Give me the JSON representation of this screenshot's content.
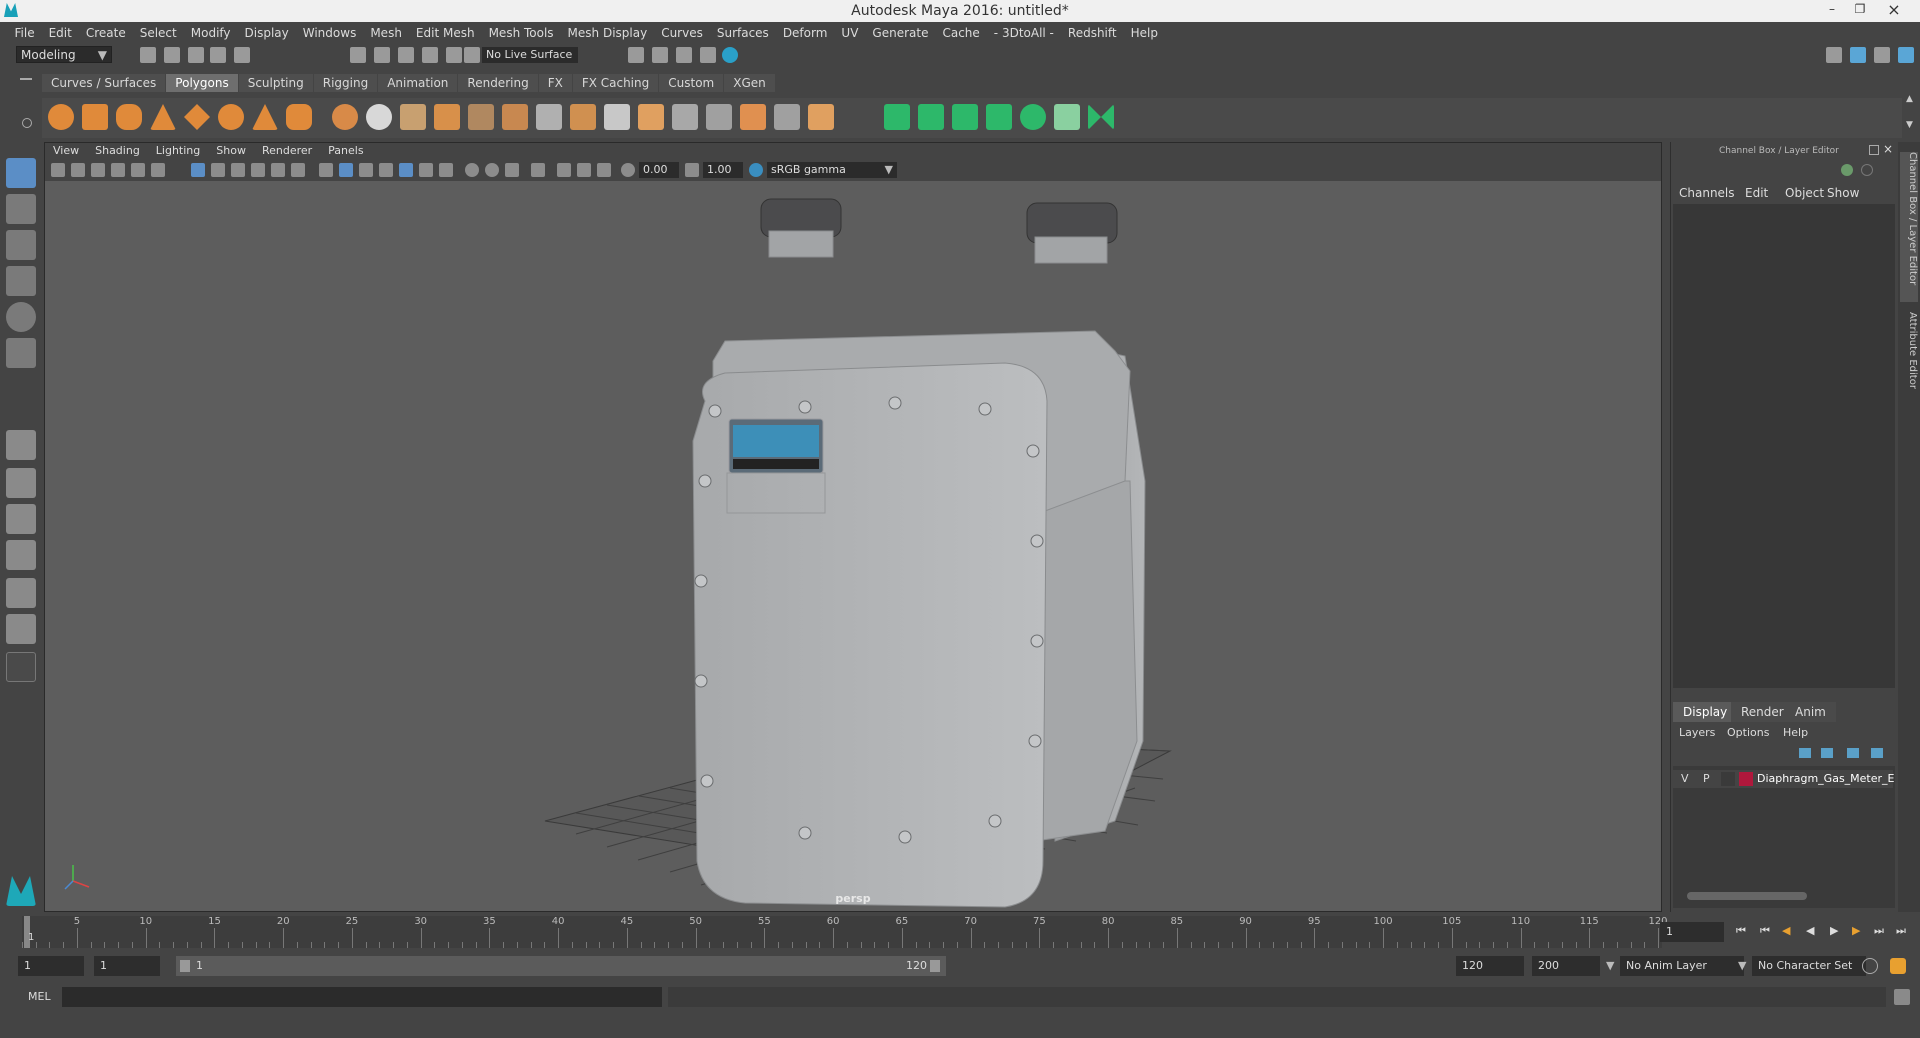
{
  "window": {
    "title": "Autodesk Maya 2016: untitled*"
  },
  "menus": [
    "File",
    "Edit",
    "Create",
    "Select",
    "Modify",
    "Display",
    "Windows",
    "Mesh",
    "Edit Mesh",
    "Mesh Tools",
    "Mesh Display",
    "Curves",
    "Surfaces",
    "Deform",
    "UV",
    "Generate",
    "Cache",
    "- 3DtoAll -",
    "Redshift",
    "Help"
  ],
  "status": {
    "mode": "Modeling",
    "live_surface": "No Live Surface"
  },
  "shelf": {
    "tabs": [
      "Curves / Surfaces",
      "Polygons",
      "Sculpting",
      "Rigging",
      "Animation",
      "Rendering",
      "FX",
      "FX Caching",
      "Custom",
      "XGen"
    ],
    "active": "Polygons"
  },
  "viewport": {
    "menu": [
      "View",
      "Shading",
      "Lighting",
      "Show",
      "Renderer",
      "Panels"
    ],
    "exposure": "0.00",
    "gamma": "1.00",
    "color_space": "sRGB gamma",
    "camera": "persp"
  },
  "channel_box": {
    "header": "Channel Box / Layer Editor",
    "menu": [
      "Channels",
      "Edit",
      "Object",
      "Show"
    ],
    "tabs": [
      "Display",
      "Render",
      "Anim"
    ],
    "active_tab": "Display",
    "layer_menu": [
      "Layers",
      "Options",
      "Help"
    ],
    "layer": {
      "v": "V",
      "p": "P",
      "name": "Diaphragm_Gas_Meter_E",
      "color": "#b0183c"
    }
  },
  "side_tabs": [
    "Channel Box / Layer Editor",
    "Attribute Editor"
  ],
  "timeline": {
    "ticks": [
      "5",
      "10",
      "15",
      "20",
      "25",
      "30",
      "35",
      "40",
      "45",
      "50",
      "55",
      "60",
      "65",
      "70",
      "75",
      "80",
      "85",
      "90",
      "95",
      "100",
      "105",
      "110",
      "115",
      "120"
    ],
    "current_frame_marker": "1",
    "current_frame": "1"
  },
  "range": {
    "start": "1",
    "playback_start": "1",
    "slider_start": "1",
    "slider_end": "120",
    "playback_end": "120",
    "end": "200",
    "anim_layer": "No Anim Layer",
    "character_set": "No Character Set"
  },
  "command": {
    "label": "MEL"
  }
}
